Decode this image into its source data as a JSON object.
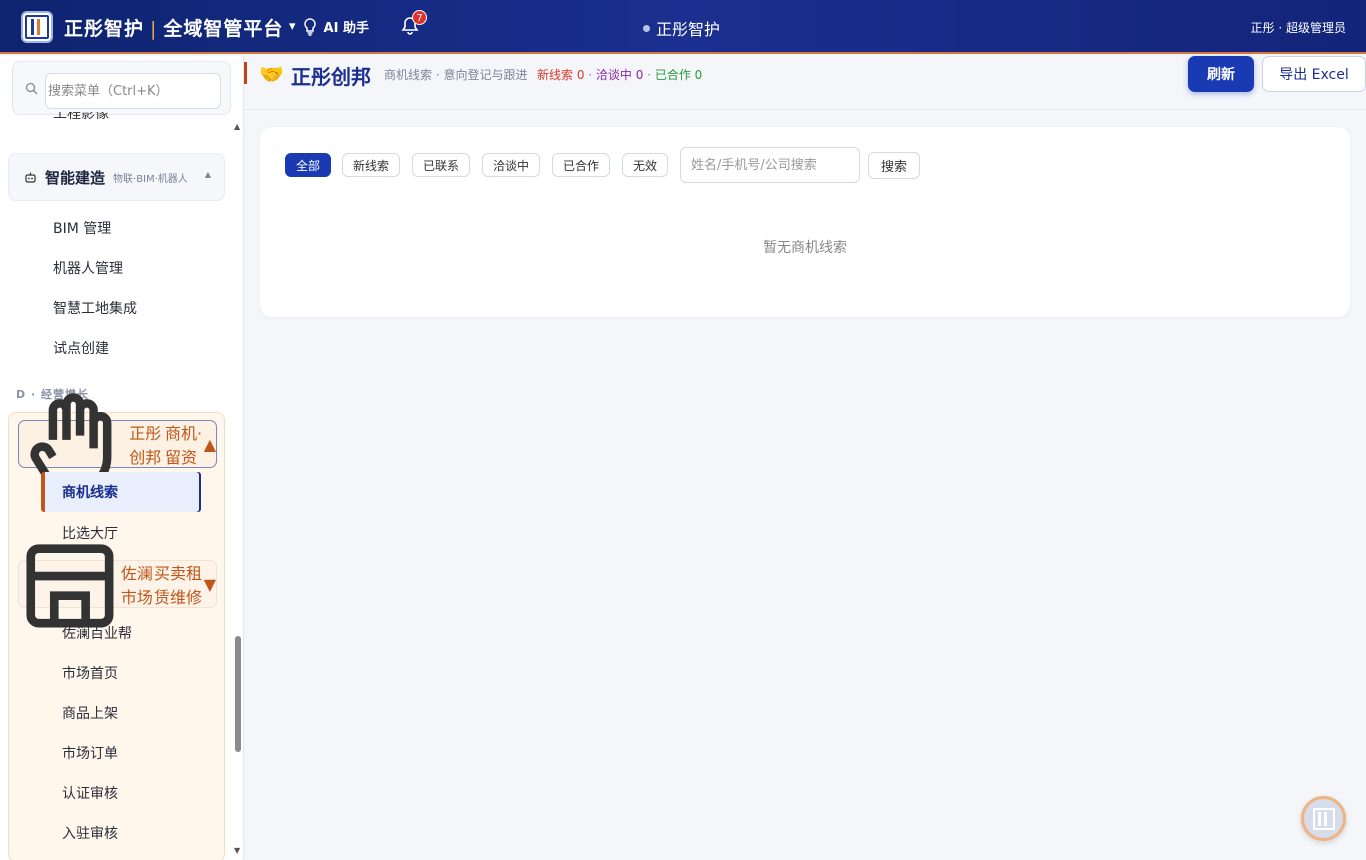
{
  "topbar": {
    "brand_left": "正彤智护",
    "brand_right": "全域智管平台",
    "ai_label": "AI 助手",
    "notification_count": "7",
    "center_title": "正彤智护",
    "user": "正彤 · 超级管理员"
  },
  "sidebar": {
    "search_placeholder": "搜索菜单（Ctrl+K）",
    "cut_item": "工程影像",
    "group_build": {
      "title": "智能建造",
      "sub": "物联·BIM·机器人"
    },
    "build_items": [
      "BIM 管理",
      "机器人管理",
      "智慧工地集成",
      "试点创建"
    ],
    "section_label": "D · 经营增长",
    "group_biz": {
      "title": "正彤创邦",
      "sub": "商机·留资"
    },
    "biz_items": [
      "商机线索",
      "比选大厅"
    ],
    "group_market": {
      "title": "佐澜市场",
      "sub": "买卖租赁维修"
    },
    "market_items": [
      "佐澜百业帮",
      "市场首页",
      "商品上架",
      "市场订单",
      "认证审核",
      "入驻审核"
    ]
  },
  "header": {
    "title": "正彤创邦",
    "subtitle": "商机线索 · 意向登记与跟进",
    "stat_new": "新线索 0",
    "stat_talk": "洽谈中 0",
    "stat_done": "已合作 0",
    "sep": " · ",
    "refresh_label": "刷新",
    "export_label": "导出 Excel"
  },
  "filters": [
    "全部",
    "新线索",
    "已联系",
    "洽谈中",
    "已合作",
    "无效"
  ],
  "search": {
    "placeholder": "姓名/手机号/公司搜索",
    "button": "搜索"
  },
  "empty_text": "暂无商机线索",
  "colors": {
    "accent": "#1a3ab3",
    "brand_orange": "#c0561a",
    "topbar": "#1a2f8f"
  }
}
